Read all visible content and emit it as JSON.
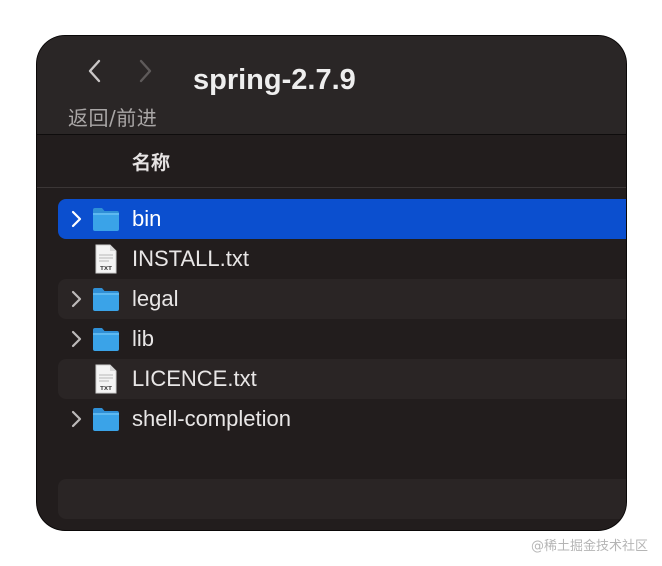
{
  "window": {
    "title": "spring-2.7.9",
    "nav_label": "返回/前进"
  },
  "icons": {
    "back": "chevron-left-icon",
    "forward": "chevron-right-icon",
    "folder": "folder-icon",
    "text_file": "text-file-icon",
    "disclosure": "disclosure-triangle-icon"
  },
  "columns": {
    "name": "名称"
  },
  "files": [
    {
      "name": "bin",
      "type": "folder",
      "selected": true
    },
    {
      "name": "INSTALL.txt",
      "type": "txt",
      "selected": false
    },
    {
      "name": "legal",
      "type": "folder",
      "selected": false
    },
    {
      "name": "lib",
      "type": "folder",
      "selected": false
    },
    {
      "name": "LICENCE.txt",
      "type": "txt",
      "selected": false
    },
    {
      "name": "shell-completion",
      "type": "folder",
      "selected": false
    }
  ],
  "txt_badge": "TXT",
  "colors": {
    "window_bg": "#221d1d",
    "toolbar_bg": "#2a2626",
    "selection": "#0b4fcf",
    "folder": "#3aa3e8"
  },
  "watermark": "@稀土掘金技术社区"
}
